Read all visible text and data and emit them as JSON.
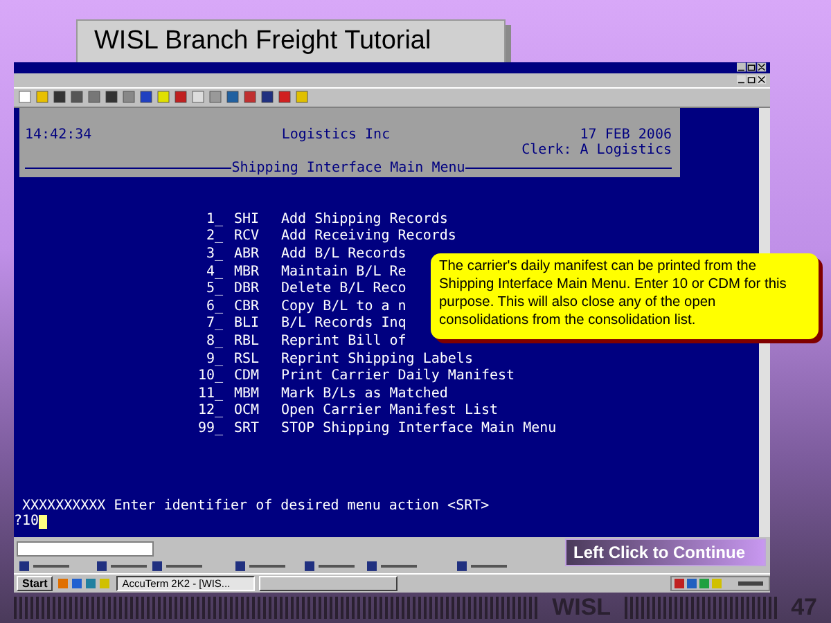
{
  "slide": {
    "title": "WISL Branch Freight Tutorial",
    "footer": "WISL",
    "page_number": "47"
  },
  "terminal": {
    "time": "14:42:34",
    "company": "Logistics Inc",
    "date": "17 FEB 2006",
    "clerk": "Clerk: A Logistics",
    "menu_title": "Shipping Interface Main Menu",
    "menu": [
      {
        "number": "1_",
        "code": "SHI",
        "label": "Add Shipping Records"
      },
      {
        "number": "2_",
        "code": "RCV",
        "label": "Add Receiving Records"
      },
      {
        "number": "3_",
        "code": "ABR",
        "label": "Add B/L Records"
      },
      {
        "number": "4_",
        "code": "MBR",
        "label": "Maintain B/L Re"
      },
      {
        "number": "5_",
        "code": "DBR",
        "label": "Delete B/L Reco"
      },
      {
        "number": "6_",
        "code": "CBR",
        "label": "Copy B/L to a n"
      },
      {
        "number": "7_",
        "code": "BLI",
        "label": "B/L Records Inq"
      },
      {
        "number": "8_",
        "code": "RBL",
        "label": "Reprint Bill of"
      },
      {
        "number": "9_",
        "code": "RSL",
        "label": "Reprint Shipping Labels"
      },
      {
        "number": "10_",
        "code": "CDM",
        "label": "Print Carrier Daily Manifest"
      },
      {
        "number": "11_",
        "code": "MBM",
        "label": "Mark B/Ls as Matched"
      },
      {
        "number": "12_",
        "code": "OCM",
        "label": "Open Carrier Manifest List"
      },
      {
        "number": "99_",
        "code": "SRT",
        "label": "STOP Shipping Interface Main Menu"
      }
    ],
    "prompt": "XXXXXXXXXX Enter identifier of desired menu action <SRT>",
    "input": "?10"
  },
  "taskbar": {
    "start": "Start",
    "tasks": [
      {
        "label": "AccuTerm 2K2 - [WIS...",
        "selected": true
      },
      {
        "selected": false
      }
    ]
  },
  "callout": "The carrier's daily manifest can be printed from the Shipping Interface Main Menu. Enter 10 or CDM for this purpose.  This will also close any of the open consolidations from the consolidation list.",
  "continue_button": "Left Click to Continue"
}
